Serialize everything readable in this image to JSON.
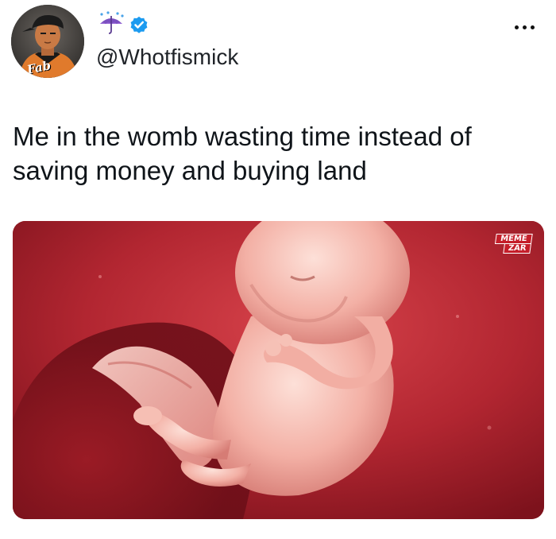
{
  "tweet": {
    "handle": "@Whotfismick",
    "display_name_emoji": "umbrella-with-rain-icon",
    "verified": true,
    "text_lines": [
      "Me in the womb wasting time instead of",
      "saving money and buying land"
    ],
    "more_menu_icon": "more-horizontal-icon"
  },
  "avatar": {
    "caption": "Fab"
  },
  "media": {
    "watermark": {
      "line1": "MEME",
      "line2": "ZAR"
    }
  },
  "colors": {
    "verified_badge": "#1d9bf0",
    "text": "#0f1419",
    "media_bg": "#9e1d26"
  }
}
